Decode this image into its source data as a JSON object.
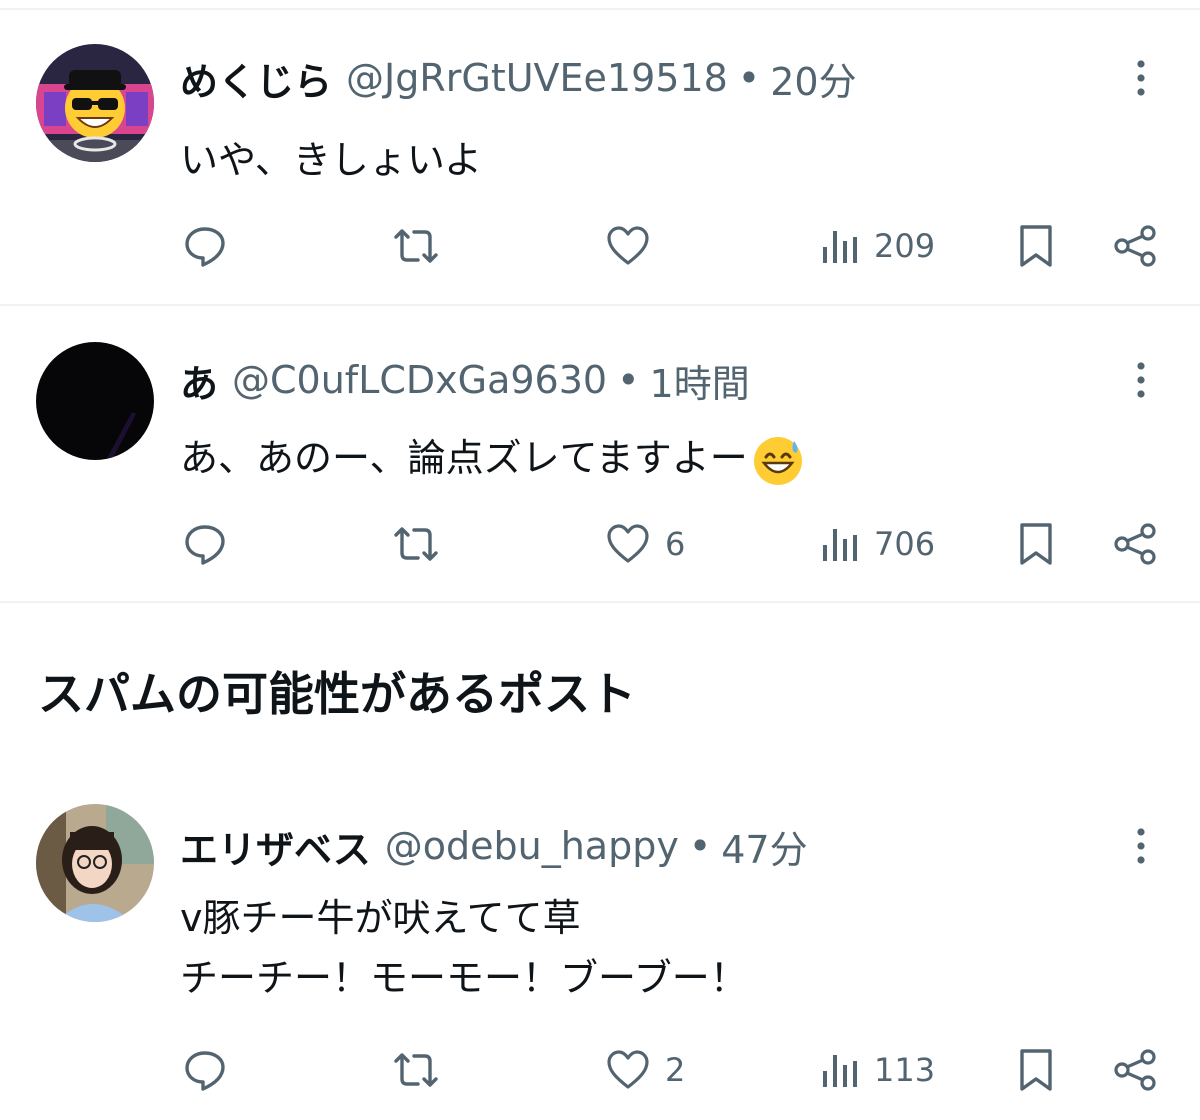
{
  "posts": [
    {
      "name": "めくじら",
      "handle": "@JgRrGtUVEe19518",
      "separator": "•",
      "time": "20分",
      "lines": [
        "いや、きしょいよ"
      ],
      "likes": "",
      "views": "209"
    },
    {
      "name": "あ",
      "handle": "@C0ufLCDxGa9630",
      "separator": "•",
      "time": "1時間",
      "lines": [
        "あ、あのー、論点ズレてますよー"
      ],
      "likes": "6",
      "views": "706"
    },
    {
      "name": "エリザベス",
      "handle": "@odebu_happy",
      "separator": "•",
      "time": "47分",
      "lines": [
        "v豚チー牛が吠えてて草",
        "チーチー！モーモー！ブーブー！"
      ],
      "likes": "2",
      "views": "113"
    }
  ],
  "section": {
    "heading": "スパムの可能性があるポスト"
  },
  "icons": {
    "reply": "reply-icon",
    "repost": "repost-icon",
    "like": "like-icon",
    "views": "views-icon",
    "bookmark": "bookmark-icon",
    "share": "share-icon",
    "more": "more-icon",
    "inline_emoji": "grinning-sweat-emoji"
  },
  "colors": {
    "text": "#0f1419",
    "secondary": "#536471",
    "divider": "#eff3f4"
  }
}
